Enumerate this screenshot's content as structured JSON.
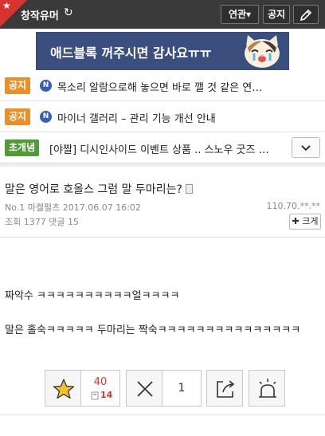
{
  "header": {
    "gallery_title": "창작유머",
    "related_label": "연관▾",
    "notice_label": "공지",
    "star_icon": "star-icon",
    "refresh_icon": "refresh-icon",
    "write_icon": "pencil-icon"
  },
  "ad": {
    "text": "애드블록 꺼주시면 감사요ㅠㅠ"
  },
  "notices": [
    {
      "badge": "공지",
      "new": "N",
      "text": "목소리 알람으로해 놓으면 바로 깰 것 같은 연…"
    },
    {
      "badge": "공지",
      "new": "N",
      "text": "마이너 갤러리 – 관리 기능 개선 안내"
    },
    {
      "badge": "초개념",
      "text": "[야짤] 디시인사이드 이벤트 상품 .. 스노우 굿즈 …"
    }
  ],
  "post": {
    "title": "말은 영어로 호올스 그럼 말 두마리는?",
    "meta1": "No.1 마켈펄츠 2017.06.07 16:02",
    "ip": "110.70.**.**",
    "meta2": "조회 1377 댓글 15",
    "enlarge_label": "✚ 크게",
    "body": [
      "짜악수 ㅋㅋㅋㅋㅋㅋㅋㅋㅋㅋ얼ㅋㅋㅋㅋ",
      "말은 홀숙ㅋㅋㅋㅋㅋ 두마리는 짝숙ㅋㅋㅋㅋㅋㅋㅋㅋㅋㅋㅋㅋㅋㅋㅋ"
    ]
  },
  "votes": {
    "up": "40",
    "fix": "14",
    "down": "1"
  },
  "colors": {
    "header_bg": "#3a3a3a",
    "accent_red": "#d9332f",
    "notice_orange": "#e8912a",
    "concept_green": "#4f9a39",
    "ad_bg": "#3a4f7e"
  }
}
